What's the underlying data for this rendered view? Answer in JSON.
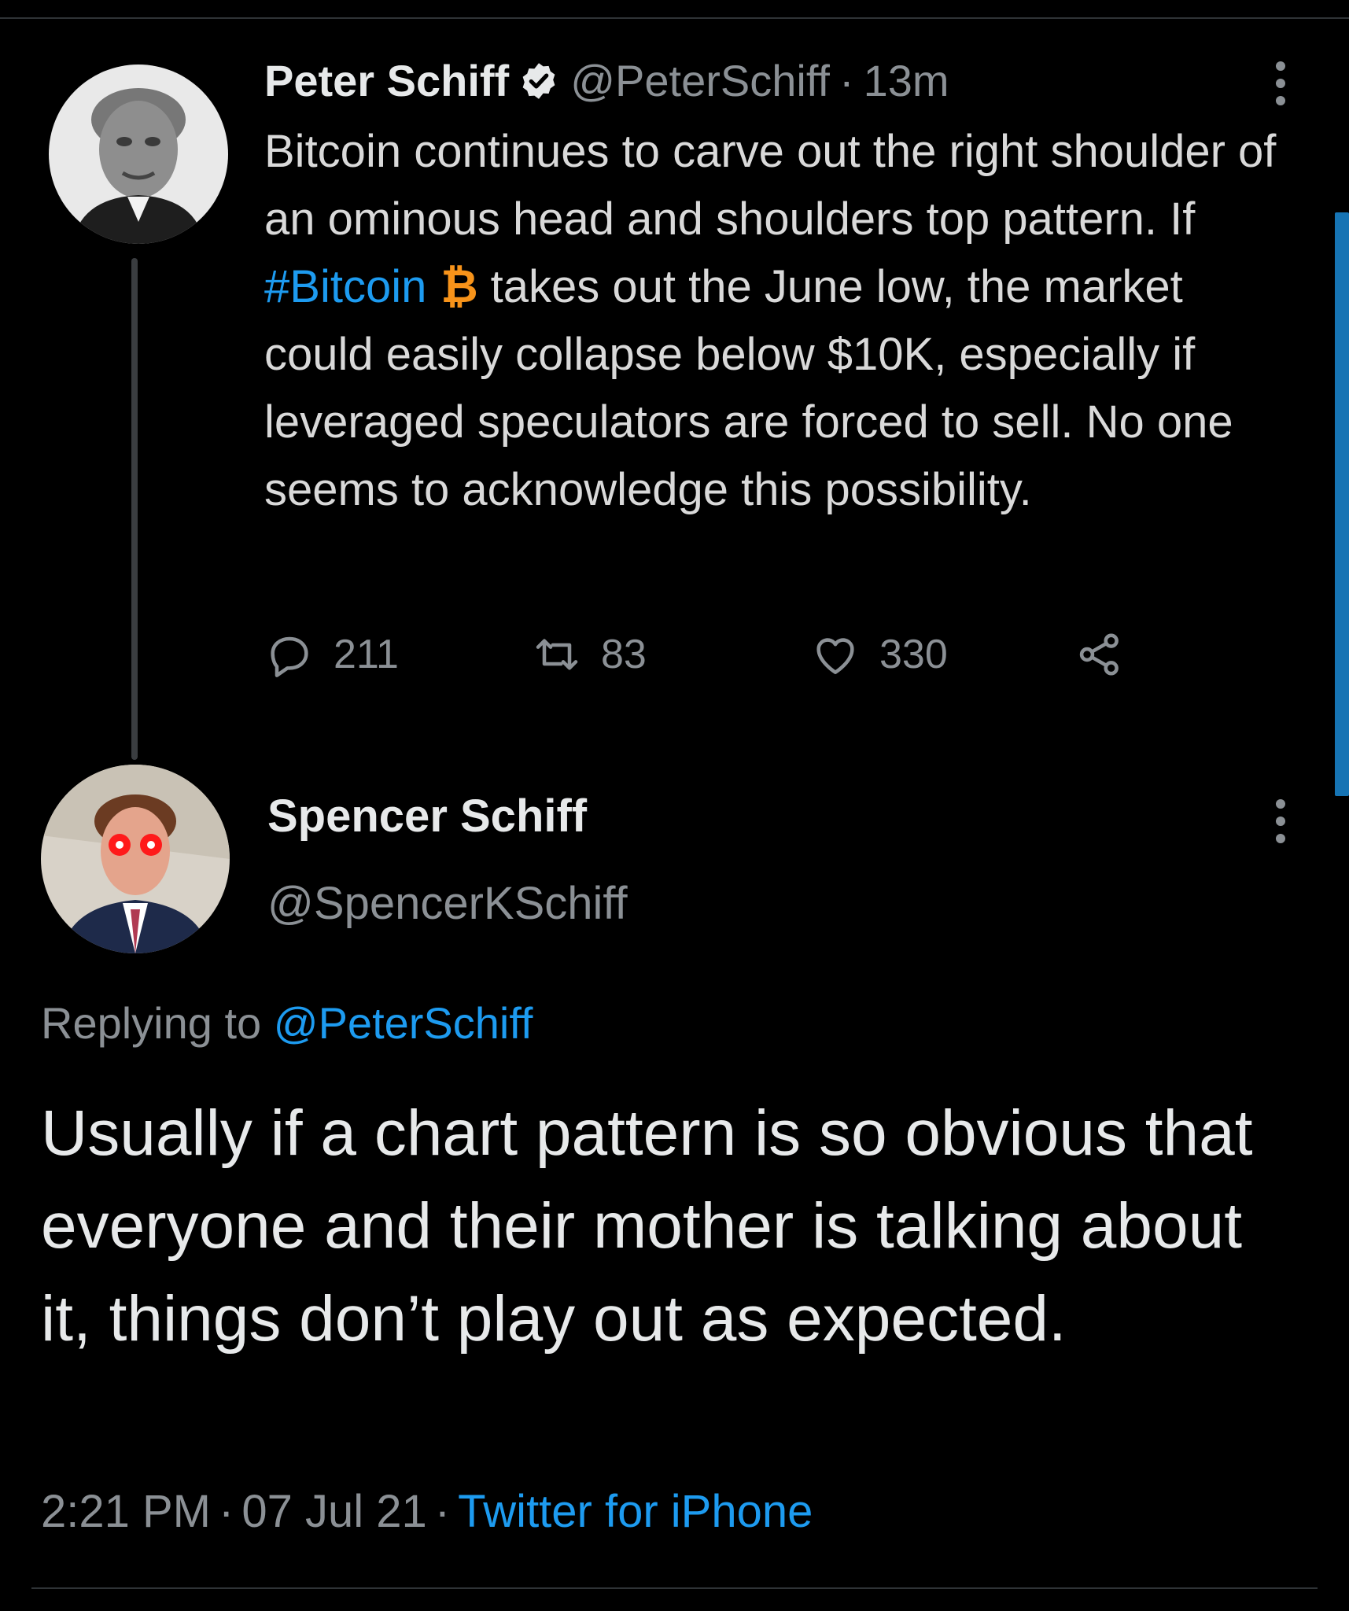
{
  "original_tweet": {
    "author_name": "Peter Schiff",
    "handle": "@PeterSchiff",
    "separator": "·",
    "time": "13m",
    "verified_icon": "verified-badge-icon",
    "text_part1": "Bitcoin continues to carve out the right shoulder of an ominous head and shoulders top pattern. If ",
    "hashtag": "#Bitcoin",
    "emoji": "₿",
    "text_part2": "takes out the June low, the market could easily collapse below $10K, especially if leveraged speculators are forced to sell. No one seems to acknowledge this possibility.",
    "stats": {
      "replies": "211",
      "retweets": "83",
      "likes": "330"
    },
    "icons": [
      "reply-icon",
      "retweet-icon",
      "like-icon",
      "share-icon",
      "more-options-icon"
    ]
  },
  "reply_tweet": {
    "author_name": "Spencer Schiff",
    "handle": "@SpencerKSchiff",
    "replying_to_prefix": "Replying to ",
    "replying_to_handle": "@PeterSchiff",
    "text": "Usually if a chart pattern is so obvious that everyone and their mother is talking about it, things don’t play out as expected.",
    "time": "2:21 PM",
    "date": "07 Jul 21",
    "separator": "·",
    "source": "Twitter for iPhone"
  },
  "colors": {
    "background": "#000000",
    "link": "#1d9bf0",
    "muted": "#8b9095",
    "bitcoin": "#f7931a"
  }
}
